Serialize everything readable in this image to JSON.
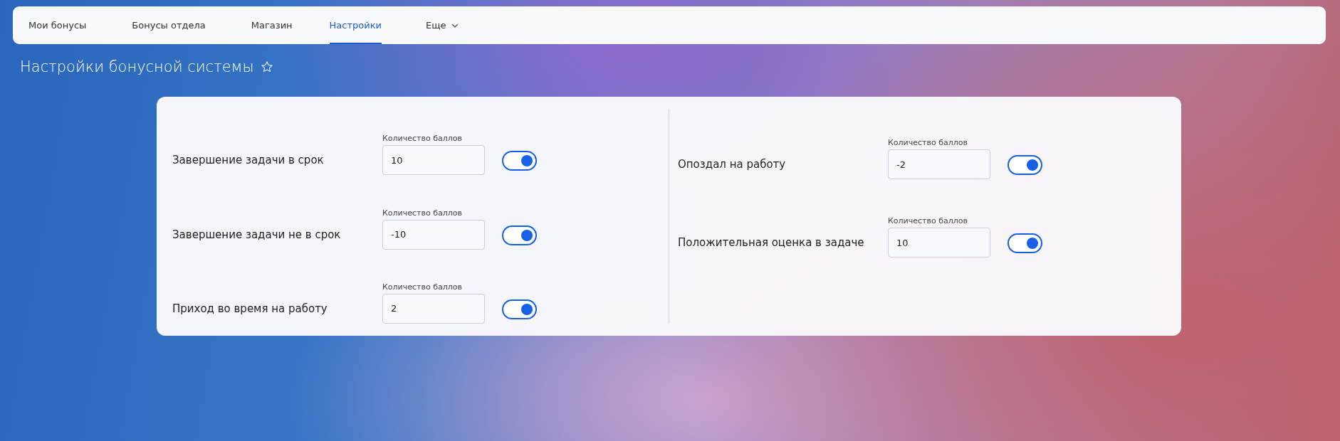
{
  "tabs": [
    {
      "label": "Мои бонусы",
      "selected": false
    },
    {
      "label": "Бонусы отдела",
      "selected": false
    },
    {
      "label": "Магазин",
      "selected": false
    },
    {
      "label": "Настройки",
      "selected": true
    },
    {
      "label": "Еще",
      "selected": false,
      "kind": "dropdown"
    }
  ],
  "page_title": "Настройки бонусной системы",
  "columns": [
    {
      "rules": [
        {
          "name": "Завершение задачи в срок",
          "field_label": "Количество баллов",
          "value": "10",
          "on": true
        },
        {
          "name": "Завершение задачи не в срок",
          "field_label": "Количество баллов",
          "value": "-10",
          "on": true
        },
        {
          "name": "Приход во время на работу",
          "field_label": "Количество баллов",
          "value": "2",
          "on": true
        }
      ]
    },
    {
      "rules": [
        {
          "name": "Опоздал на работу",
          "field_label": "Количество баллов",
          "value": "-2",
          "on": true
        },
        {
          "name": "Положительная оценка в задаче",
          "field_label": "Количество баллов",
          "value": "10",
          "on": true
        }
      ]
    }
  ]
}
